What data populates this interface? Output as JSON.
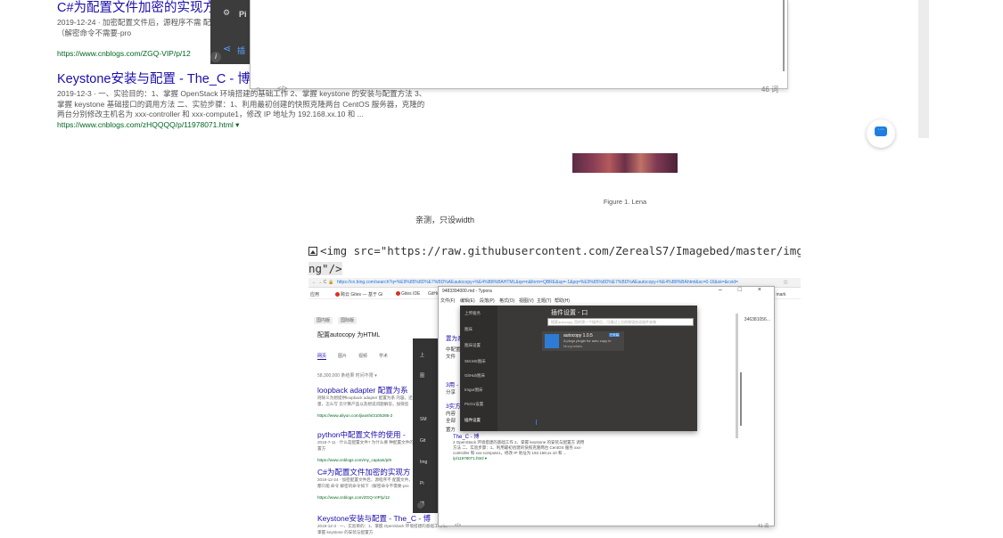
{
  "top_results": [
    {
      "title": "C#为配置文件加密的实现方",
      "desc": "2019-12-24 · 加密配置文件后，源程序不需 配置文件。不论使用哪种Provider，都只能 命令 解密的命令如下（解密命令不需要-pro",
      "url": "https://www.cnblogs.com/ZGQ-VIP/p/12"
    },
    {
      "title": "Keystone安装与配置 - The_C - 博客",
      "desc": "2019-12-3 · 一、实验目的：1、掌握 OpenStack 环境搭建的基础工作 2、掌握 keystone 的安装与配置方法 3、掌握 keystone 基础接口的调用方法 二、实验步骤：1、利用最初创建的快照克隆两台 CentOS 服务器，克隆的两台分别修改主机名为 xxx-controller 和 xxx-compute1，修改 IP 地址为 192.168.xx.10 和 ...",
      "url": "https://www.cnblogs.com/zHQQQQ/p/11978071.html ▾"
    }
  ],
  "dark_strip": {
    "label": "Pi",
    "share": "插"
  },
  "top_window": {
    "status_left": "○",
    "status_code": "</>",
    "status_right": "46 词"
  },
  "figure_caption": "Figure 1. Lena",
  "note_text": "亲测，只设width",
  "code": {
    "line1": "<img src=\"https://raw.githubusercontent.com/ZerealS7/Imagebed/master/img/2020062",
    "line2": "ng\"/>"
  },
  "nested": {
    "browser": {
      "url": "https://cn.bing.com/search?q=%E9%85%8D%E7%BD%AEautocopy+%E4%B8%BAHTML&qs=n&form=QBRE&sp=-1&pq=%E9%85%8D%E7%BD%AEautocopy+%E4%B8%BAhtml&sc=0-16&sk=&cvid=",
      "bookmarks": [
        "应用",
        "跨云 Gites — 基于 Gi",
        "Gites IDE",
        "GitHub"
      ],
      "bookmarks_right": "其他书签 · mark"
    },
    "search": {
      "tabs1": [
        "国内版",
        "国际版"
      ],
      "query": "配置autocopy 为HTML",
      "tabs2": [
        "网页",
        "图片",
        "视频",
        "学术"
      ],
      "count": "58,300,000 条结果    时间不限 ▾"
    },
    "results": [
      {
        "title": "loopback adapter 配置为系",
        "desc": "则除义为想提供loopback adapter 配置为系 内容。还有数据库盘用新增数量，怎么写 云计算产品以及想说问题解答。加快您",
        "url": "https://www.aliyun.com/jiaoshi/3105285-2"
      },
      {
        "title": "python中配置文件的使用 - ",
        "desc": "2018-7-11 · 什么是配置文件? 为什么要 种配置文件的使用，不同版本的配置方",
        "url": "https://www.cnblogs.com/my_captain/p/9"
      },
      {
        "title": "C#为配置文件加密的实现方",
        "desc": "2019-12-24 · 加密配置文件后，源程序不 配置文件。不论使用Provider，都只能 命令 解密的命令如下（解密命令不需要-pro",
        "url": "https://www.cnblogs.com/ZGQ-VIP/p/12"
      },
      {
        "title": "Keystone安装与配置 - The_C - 博",
        "desc": "2019-12-3 · 一、实验目的：1、掌握 OpenStack 环境搭建的基础工作 2、掌握 keystone 的安装与配置方",
        "url": ""
      }
    ],
    "mid_strip": [
      "上",
      "图",
      "SM",
      "Git",
      "Img",
      "Pi",
      "插"
    ],
    "typora": {
      "title": "9483394000.md - Typora",
      "controls": "– □ ×",
      "menu": [
        "文件(F)",
        "编辑(E)",
        "段落(P)",
        "格式(O)",
        "视图(V)",
        "主题(T)",
        "帮助(H)"
      ],
      "side": [
        "置为系",
        "中配置",
        "文件",
        "3用 - ",
        "分享",
        "3实方",
        "内容",
        "全部",
        "置方"
      ],
      "right_text": "346381056...",
      "status_left": "○",
      "status_code": "</>",
      "status_right": "41 词",
      "keystone_title": "The_C - 博",
      "keystone_desc": "2 OpenStack 环境搭建的基础工作 2、掌握 keystone 的安装与配置方 调用方法 二、实验步骤：1、利用最初创建的快照克隆两台 CentOS 服务 xxx-controller 和 xxx-compute1，修改 IP 地址为 192.168.xx.10 和 ...",
      "keystone_url": "/p/11978071.html ▾"
    },
    "plugin": {
      "title": "插件设置 - 口",
      "search_placeholder": "搜索autocopy, 您的第一个插件后，可通过上方的按钮启动插件安装",
      "nav": [
        "上传服务",
        "图床",
        "图床设置",
        "SM.MS图床",
        "GitHub图床",
        "Imgur图床",
        "PicGo设置",
        "插件设置"
      ],
      "card_name": "autocopy 1.0.5",
      "card_desc": "A picgo plugin for auto copy in",
      "card_author": "Mocynefalis",
      "card_badge": "已安装"
    }
  }
}
